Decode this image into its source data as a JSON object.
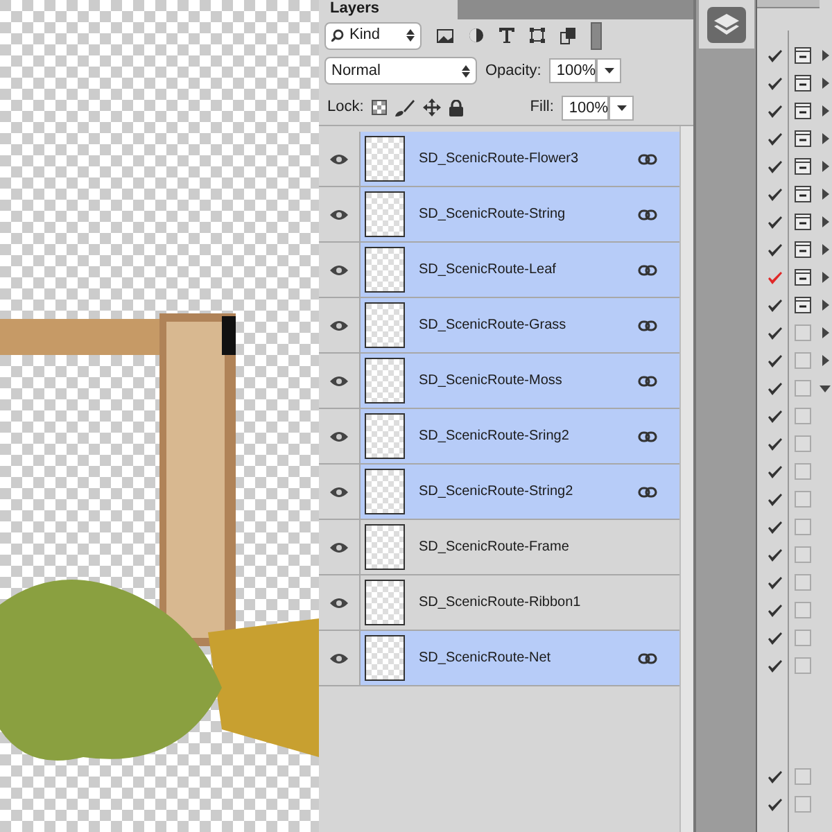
{
  "layers_panel": {
    "tab": "Layers",
    "filter": {
      "value": "Kind"
    },
    "blend_mode": {
      "value": "Normal"
    },
    "opacity": {
      "label": "Opacity:",
      "value": "100%"
    },
    "lock": {
      "label": "Lock:"
    },
    "fill": {
      "label": "Fill:",
      "value": "100%"
    },
    "layers": [
      {
        "name": "SD_ScenicRoute-Flower3",
        "visible": true,
        "selected": true,
        "linked": true
      },
      {
        "name": "SD_ScenicRoute-String",
        "visible": true,
        "selected": true,
        "linked": true
      },
      {
        "name": "SD_ScenicRoute-Leaf",
        "visible": true,
        "selected": true,
        "linked": true
      },
      {
        "name": "SD_ScenicRoute-Grass",
        "visible": true,
        "selected": true,
        "linked": true
      },
      {
        "name": "SD_ScenicRoute-Moss",
        "visible": true,
        "selected": true,
        "linked": true
      },
      {
        "name": "SD_ScenicRoute-Sring2",
        "visible": true,
        "selected": true,
        "linked": true
      },
      {
        "name": "SD_ScenicRoute-String2",
        "visible": true,
        "selected": true,
        "linked": true
      },
      {
        "name": "SD_ScenicRoute-Frame",
        "visible": true,
        "selected": false,
        "linked": false
      },
      {
        "name": "SD_ScenicRoute-Ribbon1",
        "visible": true,
        "selected": false,
        "linked": false
      },
      {
        "name": "SD_ScenicRoute-Net",
        "visible": true,
        "selected": true,
        "linked": true
      }
    ]
  },
  "side_list": [
    {
      "checked": true,
      "color": "#333333",
      "kind": "dialog",
      "expanded": false
    },
    {
      "checked": true,
      "color": "#333333",
      "kind": "dialog",
      "expanded": false
    },
    {
      "checked": true,
      "color": "#333333",
      "kind": "dialog",
      "expanded": false
    },
    {
      "checked": true,
      "color": "#333333",
      "kind": "dialog",
      "expanded": false
    },
    {
      "checked": true,
      "color": "#333333",
      "kind": "dialog",
      "expanded": false
    },
    {
      "checked": true,
      "color": "#333333",
      "kind": "dialog",
      "expanded": false
    },
    {
      "checked": true,
      "color": "#333333",
      "kind": "dialog",
      "expanded": false
    },
    {
      "checked": true,
      "color": "#333333",
      "kind": "dialog",
      "expanded": false
    },
    {
      "checked": true,
      "color": "#e02828",
      "kind": "dialog",
      "expanded": false
    },
    {
      "checked": true,
      "color": "#333333",
      "kind": "dialog",
      "expanded": false
    },
    {
      "checked": true,
      "color": "#333333",
      "kind": "empty",
      "expanded": false
    },
    {
      "checked": true,
      "color": "#333333",
      "kind": "empty",
      "expanded": false
    },
    {
      "checked": true,
      "color": "#333333",
      "kind": "empty",
      "expanded": true
    },
    {
      "checked": true,
      "color": "#333333",
      "kind": "empty"
    },
    {
      "checked": true,
      "color": "#333333",
      "kind": "empty"
    },
    {
      "checked": true,
      "color": "#333333",
      "kind": "empty"
    },
    {
      "checked": true,
      "color": "#333333",
      "kind": "empty"
    },
    {
      "checked": true,
      "color": "#333333",
      "kind": "empty"
    },
    {
      "checked": true,
      "color": "#333333",
      "kind": "empty"
    },
    {
      "checked": true,
      "color": "#333333",
      "kind": "empty"
    },
    {
      "checked": true,
      "color": "#333333",
      "kind": "empty"
    },
    {
      "checked": true,
      "color": "#333333",
      "kind": "empty"
    },
    {
      "checked": true,
      "color": "#333333",
      "kind": "empty"
    },
    {
      "checked": false,
      "kind": "none"
    },
    {
      "checked": false,
      "kind": "none"
    },
    {
      "checked": false,
      "kind": "none"
    },
    {
      "checked": true,
      "color": "#333333",
      "kind": "empty"
    },
    {
      "checked": true,
      "color": "#333333",
      "kind": "empty"
    }
  ]
}
